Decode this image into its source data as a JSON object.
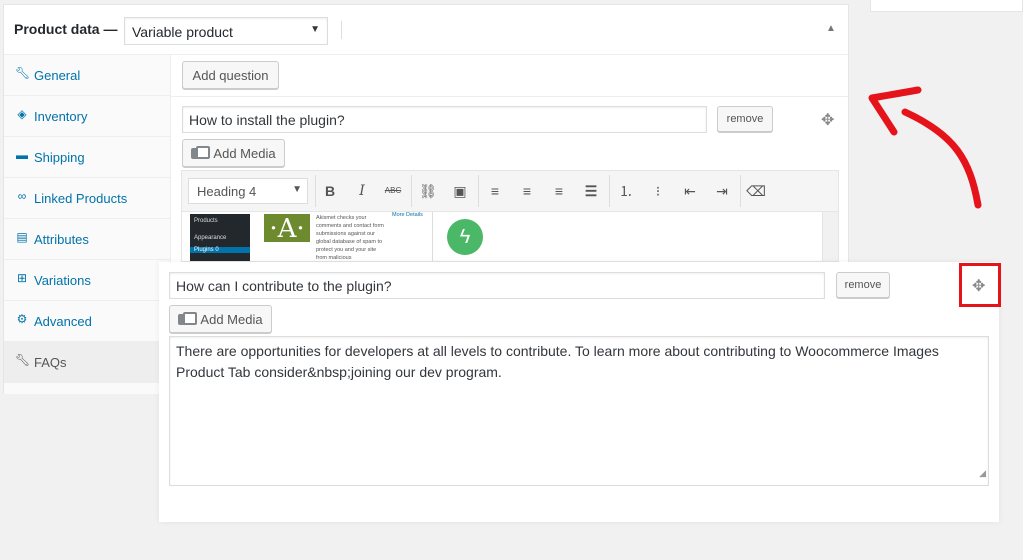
{
  "panel": {
    "title": "Product data —",
    "product_type": "Variable product",
    "collapse_icon": "triangle-up-icon"
  },
  "sidebar": {
    "items": [
      {
        "label": "General",
        "icon": "wrench-icon"
      },
      {
        "label": "Inventory",
        "icon": "tag-icon"
      },
      {
        "label": "Shipping",
        "icon": "truck-icon"
      },
      {
        "label": "Linked Products",
        "icon": "link-icon"
      },
      {
        "label": "Attributes",
        "icon": "list-icon"
      },
      {
        "label": "Variations",
        "icon": "grid-icon"
      },
      {
        "label": "Advanced",
        "icon": "gear-icon"
      },
      {
        "label": "FAQs",
        "icon": "wrench-icon"
      }
    ],
    "active": "FAQs"
  },
  "faq": {
    "add_question": "Add question",
    "remove_label": "remove",
    "add_media_label": "Add Media",
    "q1": "How to install the plugin?",
    "q2": "How can I contribute to the plugin?",
    "a2": "There are opportunities for developers at all levels to contribute. To learn more about contributing to Woocommerce Images Product Tab consider&nbsp;joining our dev program."
  },
  "editor": {
    "format": "Heading 4"
  },
  "preview": {
    "menu": [
      "Products",
      "Appearance",
      "Plugins"
    ],
    "plugin_badge": "0",
    "akismet_letter": "·A·",
    "akismet_text": "Akismet checks your comments and contact form submissions against our global database of spam to protect you and your site from malicious",
    "more_details": "More Details"
  },
  "colors": {
    "link": "#0073aa",
    "highlight_box": "#e5141b",
    "arrow": "#e5141b"
  }
}
